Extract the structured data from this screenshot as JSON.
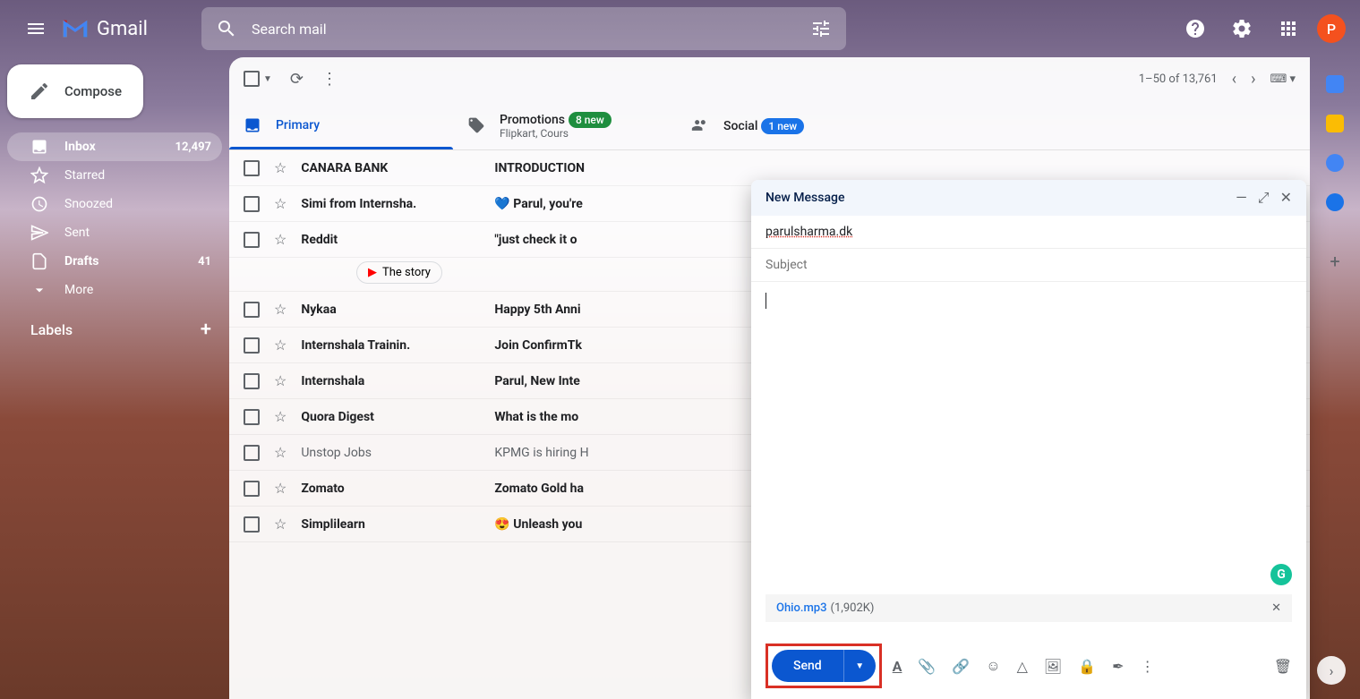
{
  "header": {
    "app_name": "Gmail",
    "search_placeholder": "Search mail",
    "avatar_letter": "P"
  },
  "sidebar": {
    "compose_label": "Compose",
    "items": [
      {
        "label": "Inbox",
        "count": "12,497",
        "active": true
      },
      {
        "label": "Starred"
      },
      {
        "label": "Snoozed"
      },
      {
        "label": "Sent"
      },
      {
        "label": "Drafts",
        "count": "41",
        "bold": true
      },
      {
        "label": "More"
      }
    ],
    "labels_header": "Labels"
  },
  "toolbar": {
    "pagination": "1–50 of 13,761"
  },
  "tabs": [
    {
      "label": "Primary",
      "active": true
    },
    {
      "label": "Promotions",
      "badge": "8 new",
      "sub": "Flipkart, Cours"
    },
    {
      "label": "Social",
      "badge": "1 new",
      "badge_class": "blue"
    }
  ],
  "emails": [
    {
      "sender": "CANARA BANK",
      "subject": "INTRODUCTION",
      "unread": true
    },
    {
      "sender": "Simi from Internsha.",
      "subject": "💙 Parul, you're",
      "unread": true
    },
    {
      "sender": "Reddit",
      "subject": "\"just check it o",
      "unread": true,
      "attachment": "The story "
    },
    {
      "sender": "Nykaa",
      "subject": "Happy 5th Anni",
      "unread": true
    },
    {
      "sender": "Internshala Trainin.",
      "subject": "Join ConfirmTk",
      "unread": true
    },
    {
      "sender": "Internshala",
      "subject": "Parul, New Inte",
      "unread": true
    },
    {
      "sender": "Quora Digest",
      "subject": "What is the mo",
      "unread": true
    },
    {
      "sender": "Unstop Jobs",
      "subject": "KPMG is hiring H",
      "unread": false
    },
    {
      "sender": "Zomato",
      "subject": "Zomato Gold ha",
      "unread": true
    },
    {
      "sender": "Simplilearn",
      "subject": "😍 Unleash you",
      "unread": true
    }
  ],
  "compose": {
    "title": "New Message",
    "recipient": "parulsharma.dk",
    "subject_placeholder": "Subject",
    "attachment_name": "Ohio.mp3",
    "attachment_size": "(1,902K)",
    "send_label": "Send"
  }
}
